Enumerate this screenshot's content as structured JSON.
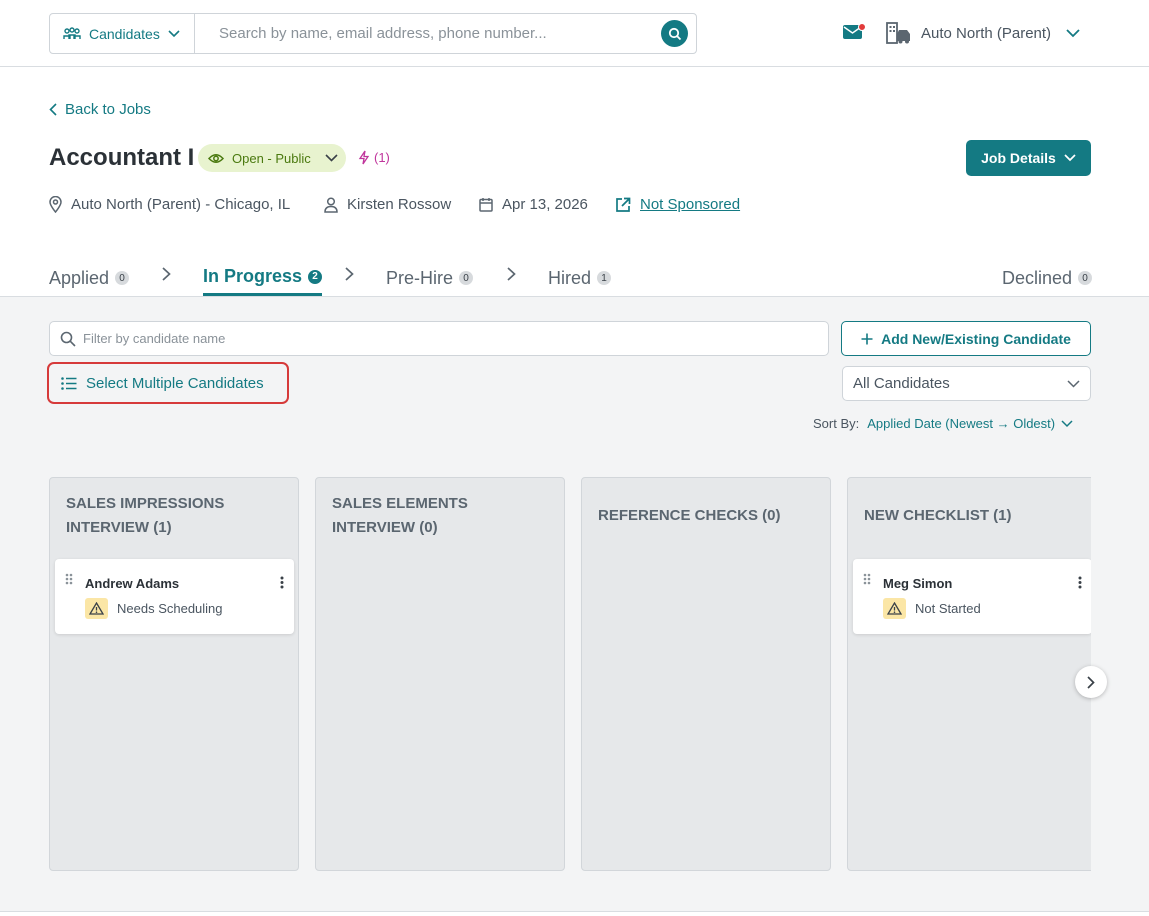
{
  "topbar": {
    "scope_label": "Candidates",
    "search_placeholder": "Search by name, email address, phone number...",
    "org_name": "Auto North (Parent)"
  },
  "job": {
    "back_label": "Back to Jobs",
    "title": "Accountant I",
    "status": "Open - Public",
    "boost_count": "(1)",
    "details_button": "Job Details",
    "location": "Auto North (Parent) - Chicago, IL",
    "recruiter": "Kirsten Rossow",
    "date": "Apr 13, 2026",
    "sponsorship": "Not Sponsored"
  },
  "stages": [
    {
      "label": "Applied",
      "count": "0"
    },
    {
      "label": "In Progress",
      "count": "2"
    },
    {
      "label": "Pre-Hire",
      "count": "0"
    },
    {
      "label": "Hired",
      "count": "1"
    },
    {
      "label": "Declined",
      "count": "0"
    }
  ],
  "controls": {
    "filter_placeholder": "Filter by candidate name",
    "add_button": "Add New/Existing Candidate",
    "select_multiple": "Select Multiple Candidates",
    "candidate_filter": "All Candidates",
    "sort_label": "Sort By:",
    "sort_value": "Applied Date (Newest → Oldest)"
  },
  "columns": [
    {
      "title": "SALES IMPRESSIONS INTERVIEW (1)",
      "cards": [
        {
          "name": "Andrew Adams",
          "status": "Needs Scheduling"
        }
      ]
    },
    {
      "title": "SALES ELEMENTS INTERVIEW (0)",
      "cards": []
    },
    {
      "title": "REFERENCE CHECKS (0)",
      "cards": []
    },
    {
      "title": "NEW CHECKLIST (1)",
      "cards": [
        {
          "name": "Meg Simon",
          "status": "Not Started"
        }
      ]
    }
  ],
  "colors": {
    "accent": "#147a83",
    "highlight": "#d63a3a",
    "warning_bg": "#fbe6a6"
  },
  "icons": [
    "people-icon",
    "search-icon",
    "mail-icon",
    "building-car-icon",
    "chevron-down-icon",
    "chevron-left-icon",
    "eye-icon",
    "bolt-icon",
    "pin-icon",
    "user-icon",
    "calendar-icon",
    "external-link-icon",
    "plus-icon",
    "list-icon",
    "drag-handle-icon",
    "kebab-icon",
    "warning-icon",
    "chevron-right-icon"
  ]
}
